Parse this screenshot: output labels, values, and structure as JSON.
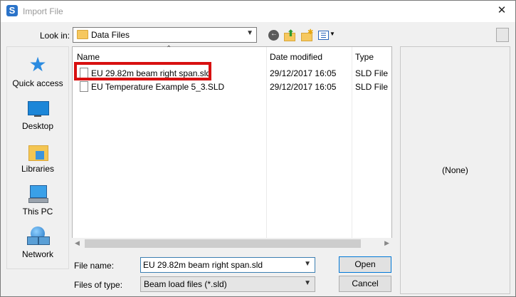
{
  "window": {
    "title": "Import File",
    "app_icon_letter": "S",
    "close_glyph": "✕"
  },
  "lookin": {
    "label": "Look in:",
    "value": "Data Files"
  },
  "toolbar": {
    "icons": [
      "back-icon",
      "up-folder-icon",
      "new-folder-icon",
      "view-menu-icon",
      "preview-toggle-icon"
    ]
  },
  "places": [
    {
      "label": "Quick access",
      "icon": "star-icon"
    },
    {
      "label": "Desktop",
      "icon": "desktop-icon"
    },
    {
      "label": "Libraries",
      "icon": "libraries-icon"
    },
    {
      "label": "This PC",
      "icon": "computer-icon"
    },
    {
      "label": "Network",
      "icon": "network-icon"
    }
  ],
  "filelist": {
    "columns": [
      "Name",
      "Date modified",
      "Type"
    ],
    "rows": [
      {
        "name": "EU 29.82m beam right span.sld",
        "date": "29/12/2017 16:05",
        "type": "SLD File"
      },
      {
        "name": "EU Temperature Example 5_3.SLD",
        "date": "29/12/2017 16:05",
        "type": "SLD File"
      }
    ]
  },
  "preview": {
    "text": "(None)"
  },
  "filename": {
    "label": "File name:",
    "value": "EU 29.82m beam right span.sld"
  },
  "filetype": {
    "label": "Files of type:",
    "value": "Beam load files (*.sld)"
  },
  "buttons": {
    "open": "Open",
    "cancel": "Cancel"
  },
  "colors": {
    "highlight": "#d81010",
    "accent": "#0078d7"
  }
}
